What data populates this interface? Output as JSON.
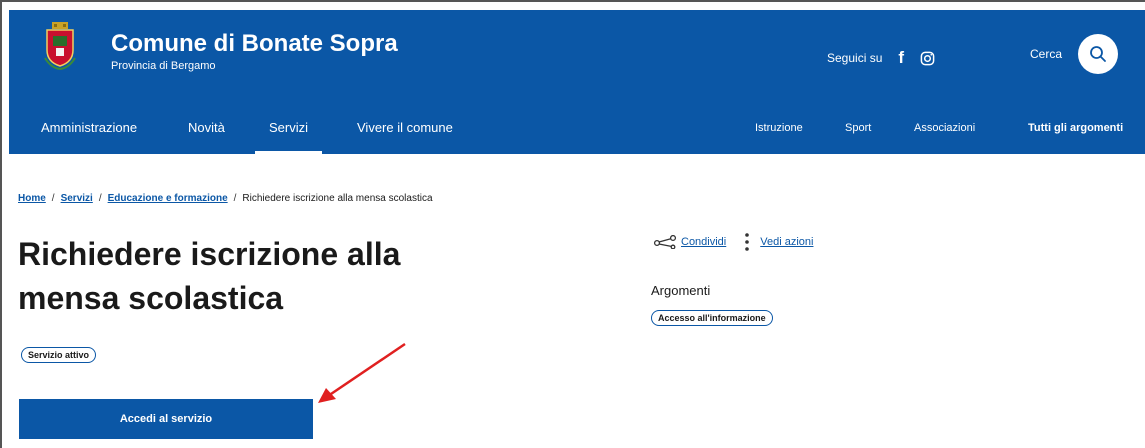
{
  "header": {
    "title": "Comune di Bonate Sopra",
    "subtitle": "Provincia di Bergamo",
    "social_label": "Seguici su",
    "search_label": "Cerca"
  },
  "nav": {
    "main": [
      "Amministrazione",
      "Novità",
      "Servizi",
      "Vivere il comune"
    ],
    "active": "Servizi",
    "topics": [
      "Istruzione",
      "Sport",
      "Associazioni",
      "Tutti gli argomenti"
    ]
  },
  "breadcrumb": {
    "home": "Home",
    "servizi": "Servizi",
    "category": "Educazione e formazione",
    "current": "Richiedere iscrizione alla mensa scolastica",
    "separator": "/"
  },
  "page": {
    "title_line1": "Richiedere iscrizione alla",
    "title_line2": "mensa scolastica",
    "status_badge": "Servizio attivo",
    "cta_label": "Accedi al servizio"
  },
  "sidebar": {
    "share_label": "Condividi",
    "actions_label": "Vedi azioni",
    "topics_heading": "Argomenti",
    "topic_tag": "Accesso all'informazione"
  },
  "colors": {
    "brand": "#0b57a6",
    "annotation_arrow": "#e02020"
  }
}
